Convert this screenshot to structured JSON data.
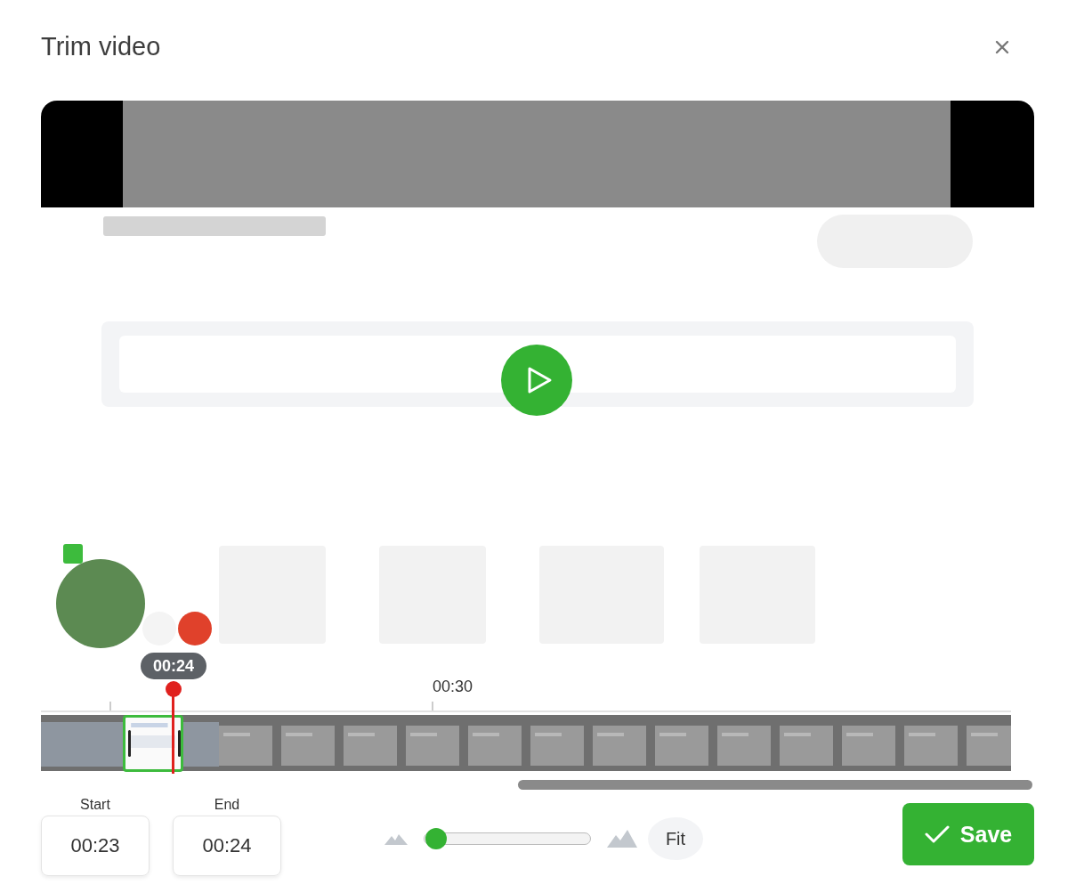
{
  "dialog": {
    "title": "Trim video"
  },
  "timeline": {
    "playhead": "00:24",
    "ticks": [
      "00:30"
    ]
  },
  "trim": {
    "start_label": "Start",
    "start": "00:23",
    "end_label": "End",
    "end": "00:24"
  },
  "zoom": {
    "level": 0.04,
    "fit": "Fit"
  },
  "save": "Save"
}
